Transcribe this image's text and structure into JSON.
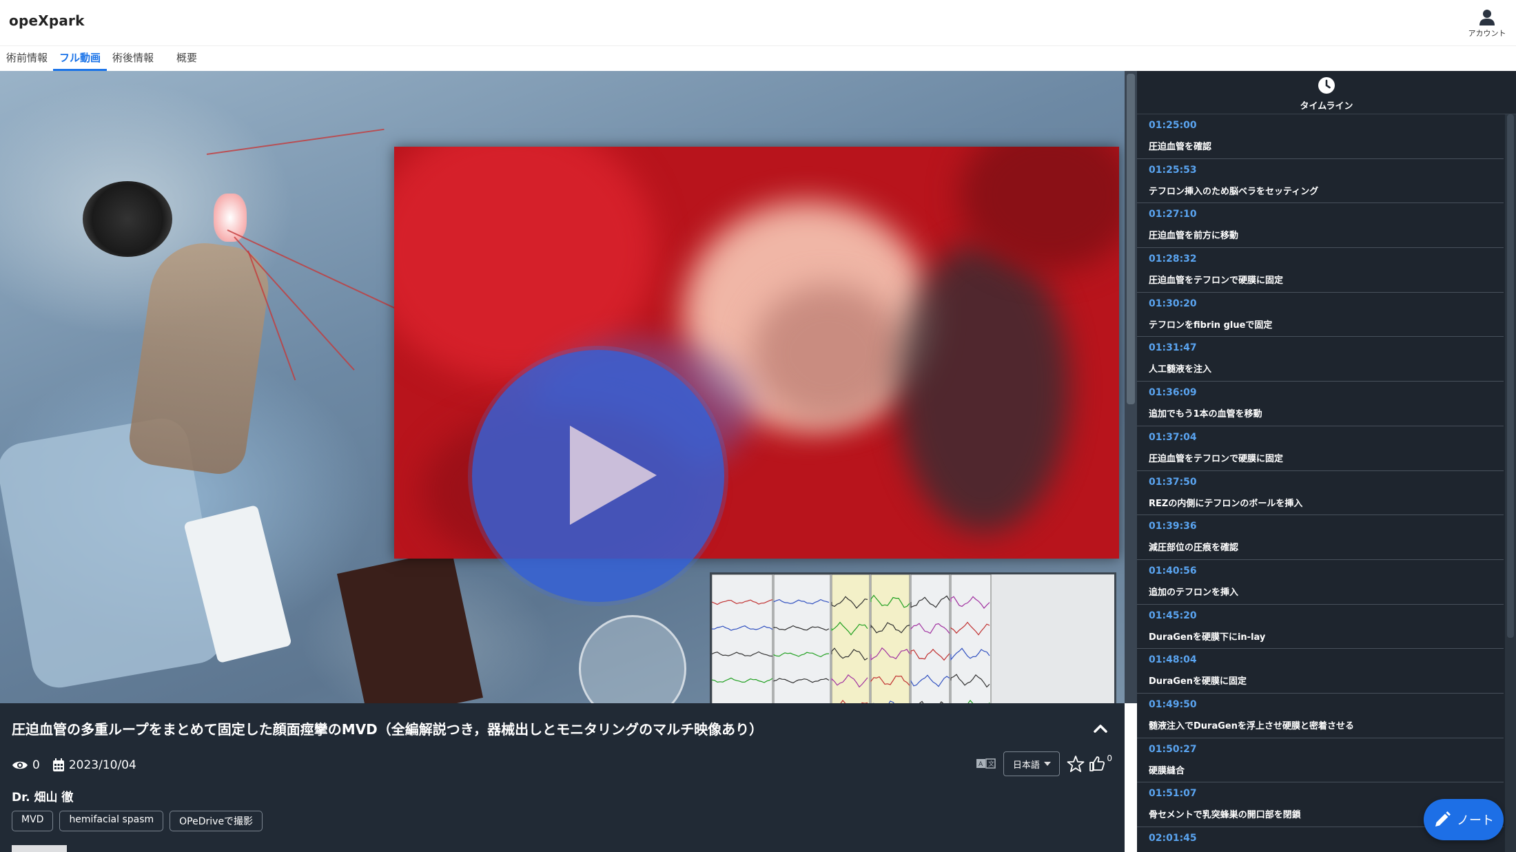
{
  "app": {
    "logo": "opeXpark"
  },
  "account": {
    "label": "アカウント",
    "icon": "user-icon"
  },
  "tabs": [
    {
      "label": "術前情報"
    },
    {
      "label": "フル動画",
      "active": true
    },
    {
      "label": "術後情報"
    },
    {
      "label": "概要"
    }
  ],
  "video": {
    "play_icon": "play-icon"
  },
  "info": {
    "title": "圧迫血管の多重ループをまとめて固定した顔面痙攣のMVD（全編解説つき，器械出しとモニタリングのマルチ映像あり）",
    "views": "0",
    "date": "2023/10/04",
    "doctor": "Dr. 畑山 徹",
    "tags": [
      "MVD",
      "hemifacial spasm",
      "OPeDriveで撮影"
    ],
    "language": "日本語",
    "likes": "0"
  },
  "timeline": {
    "header": "タイムライン",
    "items": [
      {
        "time": "01:25:00",
        "label": "圧迫血管を確認"
      },
      {
        "time": "01:25:53",
        "label": "テフロン挿入のため脳ベラをセッティング"
      },
      {
        "time": "01:27:10",
        "label": "圧迫血管を前方に移動"
      },
      {
        "time": "01:28:32",
        "label": "圧迫血管をテフロンで硬膜に固定"
      },
      {
        "time": "01:30:20",
        "label": "テフロンをfibrin glueで固定"
      },
      {
        "time": "01:31:47",
        "label": "人工髄液を注入"
      },
      {
        "time": "01:36:09",
        "label": "追加でもう1本の血管を移動"
      },
      {
        "time": "01:37:04",
        "label": "圧迫血管をテフロンで硬膜に固定"
      },
      {
        "time": "01:37:50",
        "label": "REZの内側にテフロンのボールを挿入"
      },
      {
        "time": "01:39:36",
        "label": "減圧部位の圧痕を確認"
      },
      {
        "time": "01:40:56",
        "label": "追加のテフロンを挿入"
      },
      {
        "time": "01:45:20",
        "label": "DuraGenを硬膜下にin-lay"
      },
      {
        "time": "01:48:04",
        "label": "DuraGenを硬膜に固定"
      },
      {
        "time": "01:49:50",
        "label": "髄液注入でDuraGenを浮上させ硬膜と密着させる"
      },
      {
        "time": "01:50:27",
        "label": "硬膜縫合"
      },
      {
        "time": "01:51:07",
        "label": "骨セメントで乳突蜂巣の開口部を閉鎖"
      },
      {
        "time": "02:01:45",
        "label": ""
      }
    ]
  },
  "note": {
    "label": "ノート",
    "icon": "pencil-icon"
  },
  "colors": {
    "accent": "#1a73e8",
    "timeline_time": "#5aa4f0",
    "panel": "#212a35",
    "play": "#3460d6"
  }
}
